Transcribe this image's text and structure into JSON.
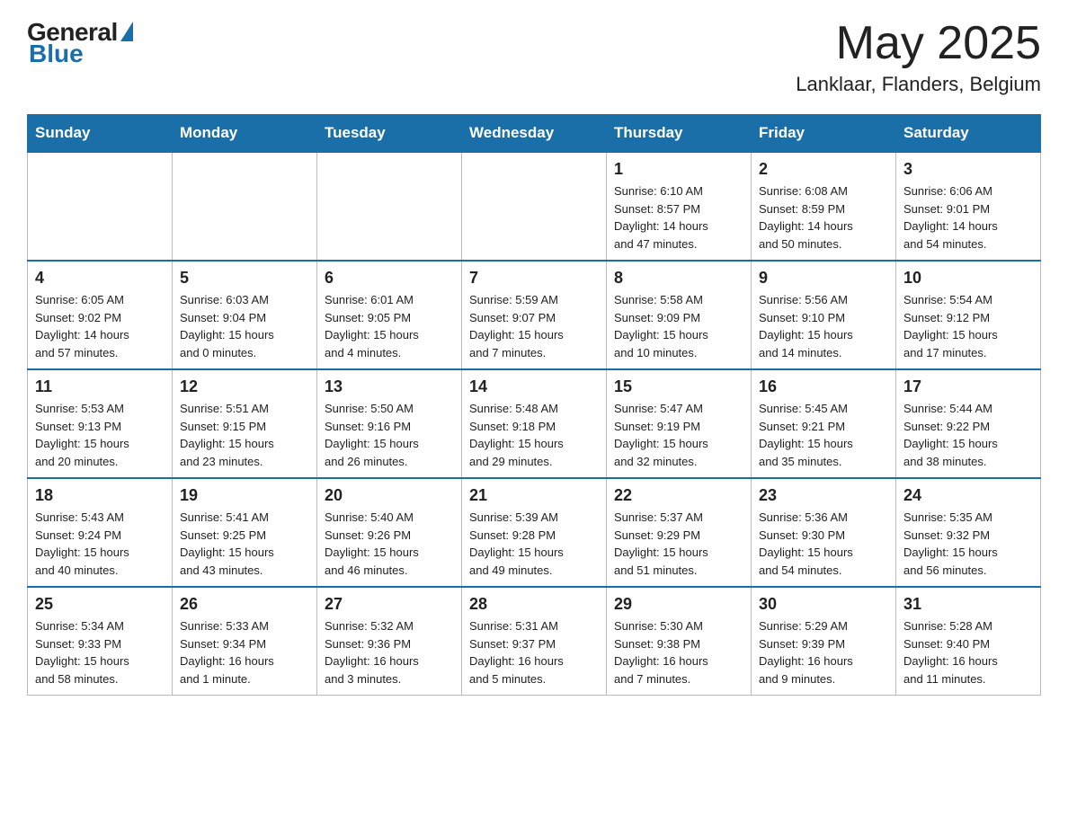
{
  "header": {
    "logo_general": "General",
    "logo_blue": "Blue",
    "month_title": "May 2025",
    "location": "Lanklaar, Flanders, Belgium"
  },
  "weekdays": [
    "Sunday",
    "Monday",
    "Tuesday",
    "Wednesday",
    "Thursday",
    "Friday",
    "Saturday"
  ],
  "weeks": [
    [
      {
        "day": "",
        "info": ""
      },
      {
        "day": "",
        "info": ""
      },
      {
        "day": "",
        "info": ""
      },
      {
        "day": "",
        "info": ""
      },
      {
        "day": "1",
        "info": "Sunrise: 6:10 AM\nSunset: 8:57 PM\nDaylight: 14 hours\nand 47 minutes."
      },
      {
        "day": "2",
        "info": "Sunrise: 6:08 AM\nSunset: 8:59 PM\nDaylight: 14 hours\nand 50 minutes."
      },
      {
        "day": "3",
        "info": "Sunrise: 6:06 AM\nSunset: 9:01 PM\nDaylight: 14 hours\nand 54 minutes."
      }
    ],
    [
      {
        "day": "4",
        "info": "Sunrise: 6:05 AM\nSunset: 9:02 PM\nDaylight: 14 hours\nand 57 minutes."
      },
      {
        "day": "5",
        "info": "Sunrise: 6:03 AM\nSunset: 9:04 PM\nDaylight: 15 hours\nand 0 minutes."
      },
      {
        "day": "6",
        "info": "Sunrise: 6:01 AM\nSunset: 9:05 PM\nDaylight: 15 hours\nand 4 minutes."
      },
      {
        "day": "7",
        "info": "Sunrise: 5:59 AM\nSunset: 9:07 PM\nDaylight: 15 hours\nand 7 minutes."
      },
      {
        "day": "8",
        "info": "Sunrise: 5:58 AM\nSunset: 9:09 PM\nDaylight: 15 hours\nand 10 minutes."
      },
      {
        "day": "9",
        "info": "Sunrise: 5:56 AM\nSunset: 9:10 PM\nDaylight: 15 hours\nand 14 minutes."
      },
      {
        "day": "10",
        "info": "Sunrise: 5:54 AM\nSunset: 9:12 PM\nDaylight: 15 hours\nand 17 minutes."
      }
    ],
    [
      {
        "day": "11",
        "info": "Sunrise: 5:53 AM\nSunset: 9:13 PM\nDaylight: 15 hours\nand 20 minutes."
      },
      {
        "day": "12",
        "info": "Sunrise: 5:51 AM\nSunset: 9:15 PM\nDaylight: 15 hours\nand 23 minutes."
      },
      {
        "day": "13",
        "info": "Sunrise: 5:50 AM\nSunset: 9:16 PM\nDaylight: 15 hours\nand 26 minutes."
      },
      {
        "day": "14",
        "info": "Sunrise: 5:48 AM\nSunset: 9:18 PM\nDaylight: 15 hours\nand 29 minutes."
      },
      {
        "day": "15",
        "info": "Sunrise: 5:47 AM\nSunset: 9:19 PM\nDaylight: 15 hours\nand 32 minutes."
      },
      {
        "day": "16",
        "info": "Sunrise: 5:45 AM\nSunset: 9:21 PM\nDaylight: 15 hours\nand 35 minutes."
      },
      {
        "day": "17",
        "info": "Sunrise: 5:44 AM\nSunset: 9:22 PM\nDaylight: 15 hours\nand 38 minutes."
      }
    ],
    [
      {
        "day": "18",
        "info": "Sunrise: 5:43 AM\nSunset: 9:24 PM\nDaylight: 15 hours\nand 40 minutes."
      },
      {
        "day": "19",
        "info": "Sunrise: 5:41 AM\nSunset: 9:25 PM\nDaylight: 15 hours\nand 43 minutes."
      },
      {
        "day": "20",
        "info": "Sunrise: 5:40 AM\nSunset: 9:26 PM\nDaylight: 15 hours\nand 46 minutes."
      },
      {
        "day": "21",
        "info": "Sunrise: 5:39 AM\nSunset: 9:28 PM\nDaylight: 15 hours\nand 49 minutes."
      },
      {
        "day": "22",
        "info": "Sunrise: 5:37 AM\nSunset: 9:29 PM\nDaylight: 15 hours\nand 51 minutes."
      },
      {
        "day": "23",
        "info": "Sunrise: 5:36 AM\nSunset: 9:30 PM\nDaylight: 15 hours\nand 54 minutes."
      },
      {
        "day": "24",
        "info": "Sunrise: 5:35 AM\nSunset: 9:32 PM\nDaylight: 15 hours\nand 56 minutes."
      }
    ],
    [
      {
        "day": "25",
        "info": "Sunrise: 5:34 AM\nSunset: 9:33 PM\nDaylight: 15 hours\nand 58 minutes."
      },
      {
        "day": "26",
        "info": "Sunrise: 5:33 AM\nSunset: 9:34 PM\nDaylight: 16 hours\nand 1 minute."
      },
      {
        "day": "27",
        "info": "Sunrise: 5:32 AM\nSunset: 9:36 PM\nDaylight: 16 hours\nand 3 minutes."
      },
      {
        "day": "28",
        "info": "Sunrise: 5:31 AM\nSunset: 9:37 PM\nDaylight: 16 hours\nand 5 minutes."
      },
      {
        "day": "29",
        "info": "Sunrise: 5:30 AM\nSunset: 9:38 PM\nDaylight: 16 hours\nand 7 minutes."
      },
      {
        "day": "30",
        "info": "Sunrise: 5:29 AM\nSunset: 9:39 PM\nDaylight: 16 hours\nand 9 minutes."
      },
      {
        "day": "31",
        "info": "Sunrise: 5:28 AM\nSunset: 9:40 PM\nDaylight: 16 hours\nand 11 minutes."
      }
    ]
  ]
}
